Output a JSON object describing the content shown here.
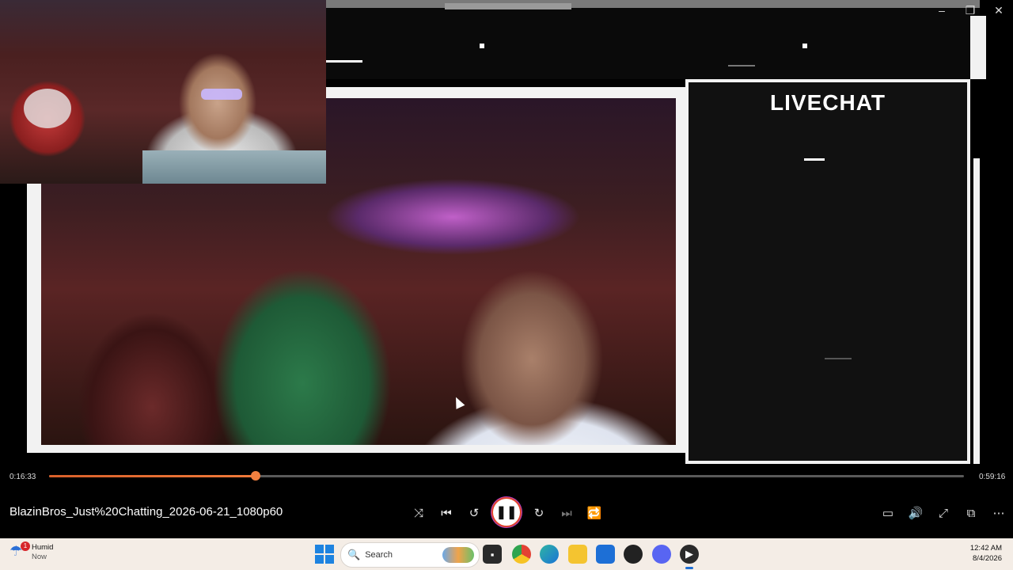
{
  "window": {
    "min": "–",
    "restore": "❐",
    "close": "✕"
  },
  "overlay": {
    "chat_title": "LIVECHAT"
  },
  "player": {
    "elapsed": "0:16:33",
    "duration": "0:59:16",
    "progress": 0.2255,
    "title": "BlazinBros_Just%20Chatting_2026-06-21_1080p60",
    "icons": {
      "shuffle": "⤨",
      "prev": "⏮",
      "rewind": "↺",
      "play_pause": "❚❚",
      "forward": "↻",
      "next": "⏭",
      "repeat": "🔁",
      "subtitles": "▭",
      "volume": "🔊",
      "fullscreen": "⤢",
      "miniplayer": "⧉",
      "more": "⋯"
    }
  },
  "taskbar": {
    "weather_label": "Humid",
    "weather_sub": "Now",
    "notification_count": "1",
    "search_label": "Search",
    "time": "12:42 AM",
    "date": "8/4/2026",
    "start_icon": "windows-icon",
    "search_icon": "🔍"
  }
}
